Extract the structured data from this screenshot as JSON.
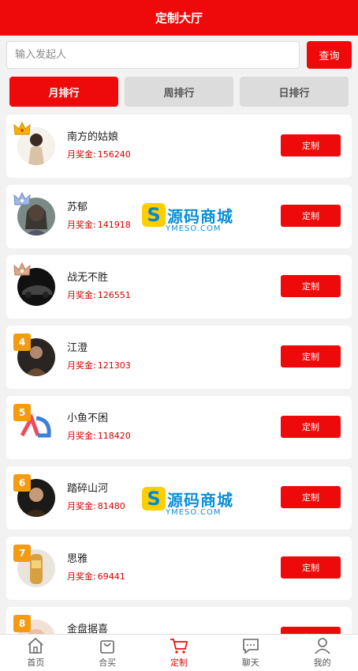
{
  "header": {
    "title": "定制大厅"
  },
  "search": {
    "placeholder": "输入发起人",
    "value": "",
    "button_label": "查询"
  },
  "tabs": [
    {
      "label": "月排行",
      "active": true
    },
    {
      "label": "周排行",
      "active": false
    },
    {
      "label": "日排行",
      "active": false
    }
  ],
  "bonus_label": "月奖金:",
  "list": [
    {
      "rank": "1",
      "name": "南方的姑娘",
      "bonus": "156240",
      "button": "定制"
    },
    {
      "rank": "2",
      "name": "苏郁",
      "bonus": "141918",
      "button": "定制"
    },
    {
      "rank": "3",
      "name": "战无不胜",
      "bonus": "126551",
      "button": "定制"
    },
    {
      "rank": "4",
      "name": "江澄",
      "bonus": "121303",
      "button": "定制"
    },
    {
      "rank": "5",
      "name": "小鱼不困",
      "bonus": "118420",
      "button": "定制"
    },
    {
      "rank": "6",
      "name": "踏碎山河",
      "bonus": "81480",
      "button": "定制"
    },
    {
      "rank": "7",
      "name": "思雅",
      "bonus": "69441",
      "button": "定制"
    },
    {
      "rank": "8",
      "name": "金盘据喜",
      "bonus": "",
      "button": "定制"
    }
  ],
  "watermark": {
    "text": "源码商城",
    "sub": "YMESO.COM"
  },
  "nav": [
    {
      "label": "首页",
      "icon": "home-icon",
      "active": false
    },
    {
      "label": "合买",
      "icon": "bag-icon",
      "active": false
    },
    {
      "label": "定制",
      "icon": "cart-icon",
      "active": true
    },
    {
      "label": "聊天",
      "icon": "chat-icon",
      "active": false
    },
    {
      "label": "我的",
      "icon": "user-icon",
      "active": false
    }
  ],
  "colors": {
    "primary": "#ee0a0a",
    "gold": "#f39c12",
    "silver": "#8aa8d8",
    "bronze": "#d09a7a"
  }
}
